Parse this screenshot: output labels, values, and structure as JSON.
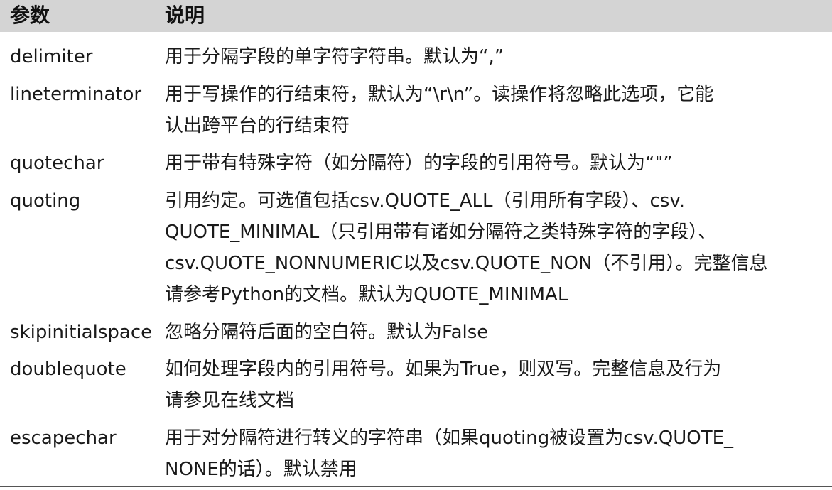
{
  "header": {
    "param_label": "参数",
    "desc_label": "说明"
  },
  "rows": [
    {
      "param": "delimiter",
      "lines": [
        "用于分隔字段的单字符字符串。默认为“,”"
      ]
    },
    {
      "param": "lineterminator",
      "lines": [
        "用于写操作的行结束符，默认为“\\r\\n”。读操作将忽略此选项，它能",
        "认出跨平台的行结束符"
      ]
    },
    {
      "param": "quotechar",
      "lines": [
        "用于带有特殊字符（如分隔符）的字段的引用符号。默认为“\"”"
      ]
    },
    {
      "param": "quoting",
      "lines": [
        "引用约定。可选值包括csv.QUOTE_ALL（引用所有字段）、csv.",
        "QUOTE_MINIMAL（只引用带有诸如分隔符之类特殊字符的字段）、",
        "csv.QUOTE_NONNUMERIC以及csv.QUOTE_NON（不引用）。完整信息",
        "请参考Python的文档。默认为QUOTE_MINIMAL"
      ]
    },
    {
      "param": "skipinitialspace",
      "lines": [
        "忽略分隔符后面的空白符。默认为False"
      ]
    },
    {
      "param": "doublequote",
      "lines": [
        "如何处理字段内的引用符号。如果为True，则双写。完整信息及行为",
        "请参见在线文档"
      ]
    },
    {
      "param": "escapechar",
      "lines": [
        "用于对分隔符进行转义的字符串（如果quoting被设置为csv.QUOTE_",
        "NONE的话）。默认禁用"
      ]
    }
  ]
}
